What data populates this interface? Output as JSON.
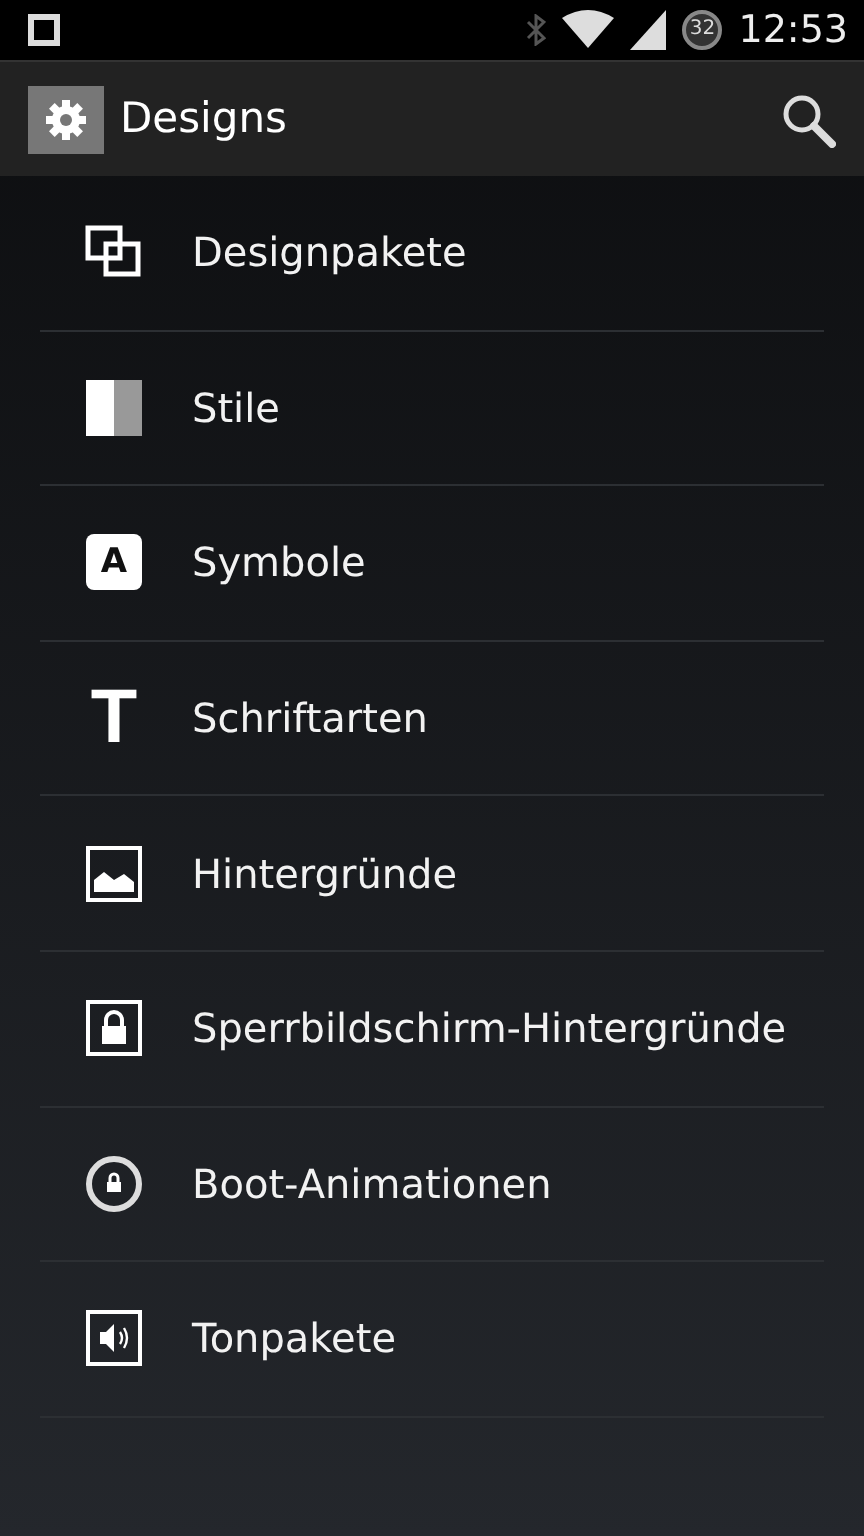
{
  "status_bar": {
    "battery": "32",
    "time": "12:53"
  },
  "app_bar": {
    "title": "Designs"
  },
  "items": [
    {
      "kind": "packs",
      "label": "Designpakete"
    },
    {
      "kind": "styles",
      "label": "Stile"
    },
    {
      "kind": "symbols",
      "label": "Symbole",
      "icon_text": "A"
    },
    {
      "kind": "fonts",
      "label": "Schriftarten",
      "icon_text": "T"
    },
    {
      "kind": "wallpapers",
      "label": "Hintergründe"
    },
    {
      "kind": "lockscreen",
      "label": "Sperrbildschirm-Hintergründe"
    },
    {
      "kind": "boot",
      "label": "Boot-Animationen"
    },
    {
      "kind": "sounds",
      "label": "Tonpakete"
    }
  ]
}
